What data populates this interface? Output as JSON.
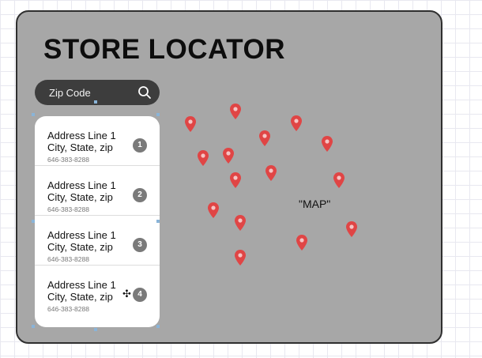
{
  "header": {
    "title": "STORE LOCATOR"
  },
  "search": {
    "placeholder": "Zip Code",
    "icon": "search-icon"
  },
  "results": [
    {
      "number": "1",
      "address_line1": "Address Line 1",
      "address_line2": "City, State, zip",
      "phone": "646-383-8288"
    },
    {
      "number": "2",
      "address_line1": "Address Line 1",
      "address_line2": "City, State, zip",
      "phone": "646-383-8288"
    },
    {
      "number": "3",
      "address_line1": "Address Line 1",
      "address_line2": "City, State, zip",
      "phone": "646-383-8288"
    },
    {
      "number": "4",
      "address_line1": "Address Line 1",
      "address_line2": "City, State, zip",
      "phone": "646-383-8288"
    }
  ],
  "map": {
    "label": "\"MAP\"",
    "pin_icon": "map-pin-icon",
    "pin_color": "#e04545"
  },
  "colors": {
    "frame_background": "#a7a7a7",
    "search_background": "#3d3d3d",
    "badge_background": "#7a7a7a"
  }
}
